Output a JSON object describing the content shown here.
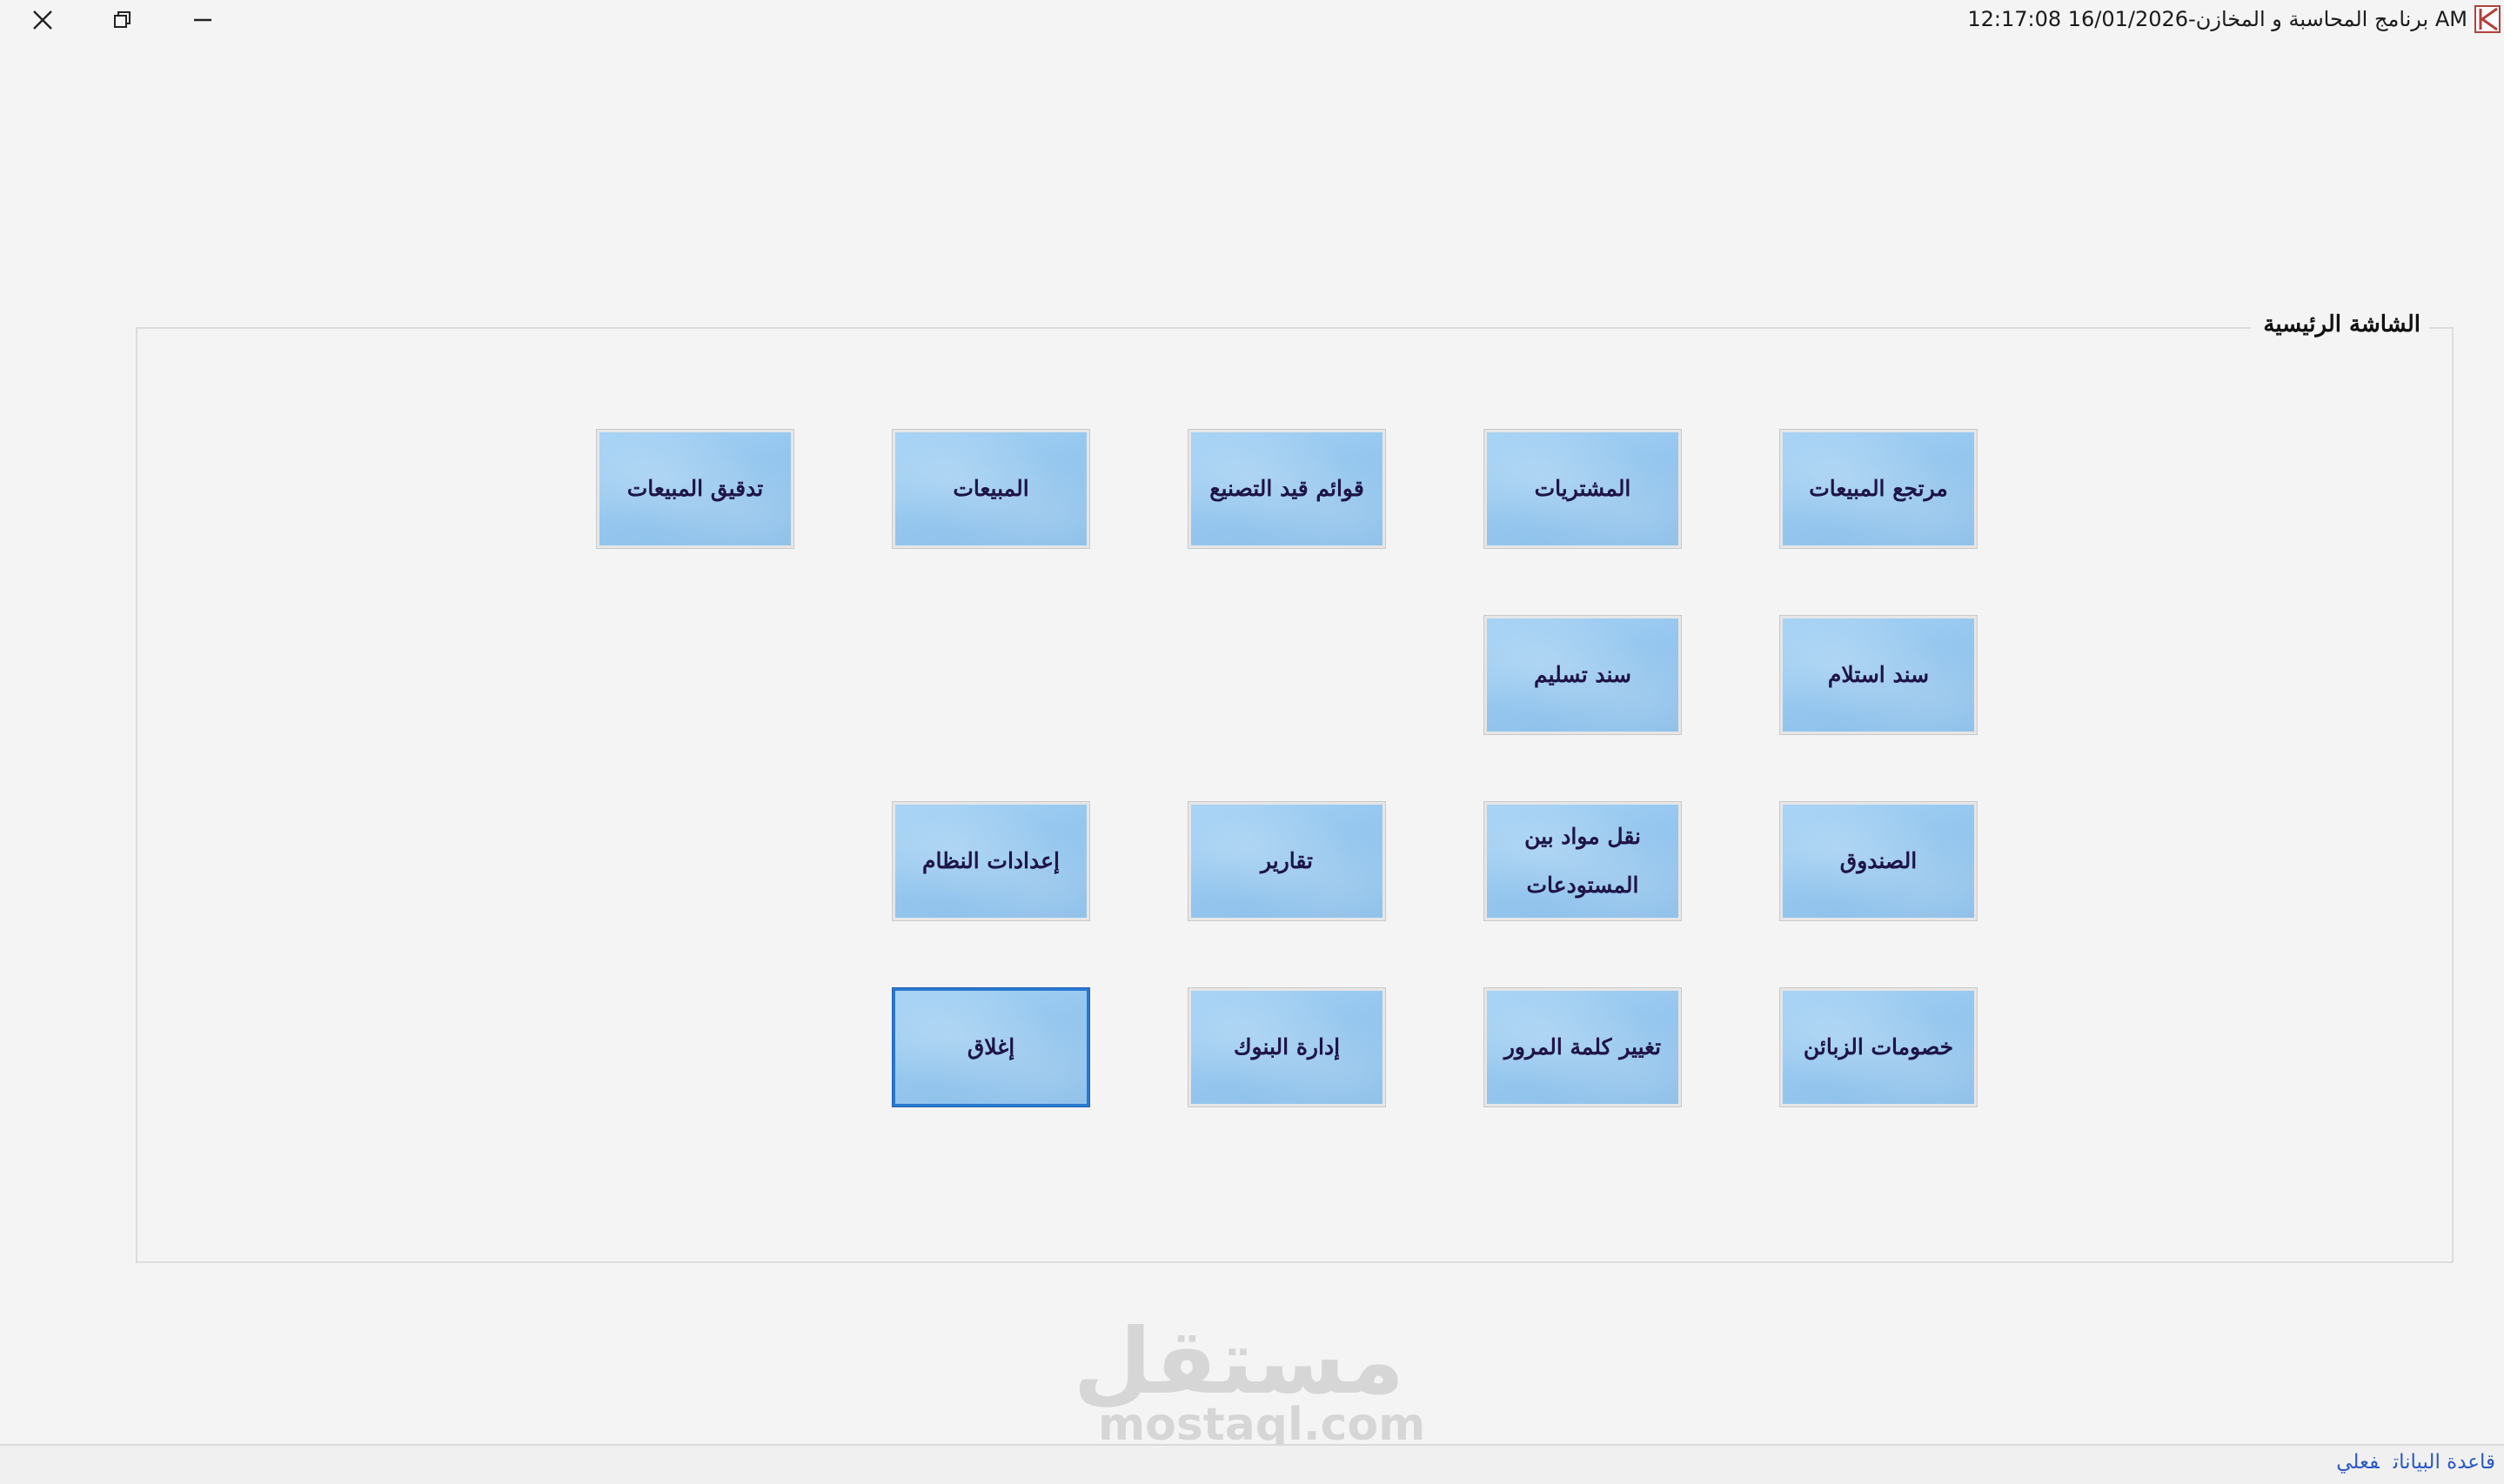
{
  "window": {
    "title": "برنامج المحاسبة و المخازن-16/01/2026 12:17:08 AM",
    "controls": {
      "close": "✕",
      "restore": "❐",
      "minimize": "—"
    }
  },
  "main": {
    "group_title": "الشاشة الرئيسية",
    "buttons": {
      "sales_returns": "مرتجع المبيعات",
      "purchases": "المشتريات",
      "manufacturing_lists": "قوائم قيد التصنيع",
      "sales": "المبيعات",
      "sales_audit": "تدقيق المبيعات",
      "receipt_voucher": "سند استلام",
      "delivery_voucher": "سند تسليم",
      "cash_box": "الصندوق",
      "transfer_materials": "نقل مواد بين المستودعات",
      "reports": "تقارير",
      "system_settings": "إعدادات النظام",
      "customer_discounts": "خصومات الزبائن",
      "change_password": "تغيير كلمة المرور",
      "bank_management": "إدارة البنوك",
      "close": "إغلاق"
    }
  },
  "watermark": {
    "arabic": "مستقل",
    "latin": "mostaql.com"
  },
  "statusbar": {
    "database_label": "قاعدة البيانات",
    "database_value": "فعلي"
  },
  "colors": {
    "tile": "#94c6ee",
    "tile_text": "#1e1446",
    "focus_border": "#2a78d0",
    "status_text": "#2a58c8"
  }
}
